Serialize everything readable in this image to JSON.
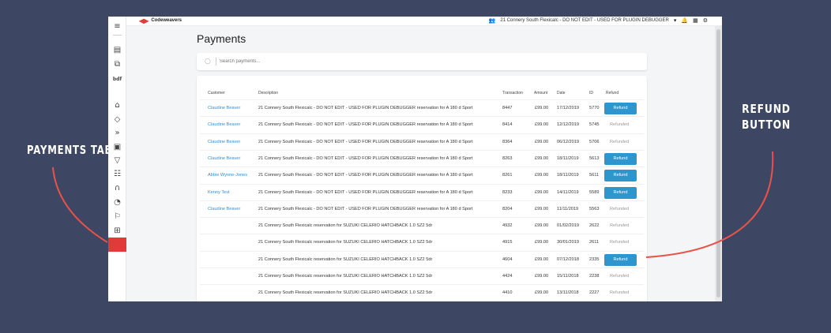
{
  "annotations": {
    "left": "Payments tab",
    "right": "Refund button"
  },
  "topbar": {
    "brand": "Codeweavers",
    "account": "21 Connery South Flexicalc - DO NOT EDIT - USED FOR PLUGIN DEBUGGER",
    "icons": [
      "users-icon",
      "caret-down-icon",
      "bell-icon",
      "grid-icon",
      "cogs-icon"
    ]
  },
  "sidebar": {
    "icons": [
      "menu-icon",
      "document-icon",
      "tag-box-icon",
      "bmf-icon",
      "bank-icon",
      "tag-icon",
      "double-chevron-icon",
      "car-icon",
      "filter-icon",
      "report-icon",
      "routing-icon",
      "tachometer-icon",
      "flag-icon",
      "sitemap-icon",
      "wallet-icon"
    ],
    "active": "wallet-icon"
  },
  "page": {
    "title": "Payments"
  },
  "search": {
    "placeholder": "Search payments..."
  },
  "table": {
    "headers": {
      "customer": "Customer",
      "description": "Description",
      "transaction": "Transaction",
      "amount": "Amount",
      "date": "Date",
      "id": "ID",
      "refund": "Refund"
    },
    "rows": [
      {
        "customer": "Claudine Beaver",
        "description": "21 Connery South Flexicalc - DO NOT EDIT - USED FOR PLUGIN DEBUGGER reservation for A 180 d Sport",
        "transaction": "8447",
        "amount": "£99.00",
        "date": "17/12/2019",
        "id": "5770",
        "refund": "Refund"
      },
      {
        "customer": "Claudine Beaver",
        "description": "21 Connery South Flexicalc - DO NOT EDIT - USED FOR PLUGIN DEBUGGER reservation for A 180 d Sport",
        "transaction": "8414",
        "amount": "£99.00",
        "date": "12/12/2019",
        "id": "5745",
        "refund": "Refunded"
      },
      {
        "customer": "Claudine Beaver",
        "description": "21 Connery South Flexicalc - DO NOT EDIT - USED FOR PLUGIN DEBUGGER reservation for A 180 d Sport",
        "transaction": "8364",
        "amount": "£99.00",
        "date": "06/12/2019",
        "id": "5706",
        "refund": "Refunded"
      },
      {
        "customer": "Claudine Beaver",
        "description": "21 Connery South Flexicalc - DO NOT EDIT - USED FOR PLUGIN DEBUGGER reservation for A 180 d Sport",
        "transaction": "8263",
        "amount": "£99.00",
        "date": "18/11/2019",
        "id": "5613",
        "refund": "Refund"
      },
      {
        "customer": "Abbie Wynne-Jones",
        "description": "21 Connery South Flexicalc - DO NOT EDIT - USED FOR PLUGIN DEBUGGER reservation for A 180 d Sport",
        "transaction": "8261",
        "amount": "£99.00",
        "date": "18/11/2019",
        "id": "5611",
        "refund": "Refund"
      },
      {
        "customer": "Kenny Test",
        "description": "21 Connery South Flexicalc - DO NOT EDIT - USED FOR PLUGIN DEBUGGER reservation for A 180 d Sport",
        "transaction": "8233",
        "amount": "£99.00",
        "date": "14/11/2019",
        "id": "5589",
        "refund": "Refund"
      },
      {
        "customer": "Claudine Beaver",
        "description": "21 Connery South Flexicalc - DO NOT EDIT - USED FOR PLUGIN DEBUGGER reservation for A 180 d Sport",
        "transaction": "8204",
        "amount": "£99.00",
        "date": "11/11/2019",
        "id": "5563",
        "refund": "Refunded"
      },
      {
        "customer": "",
        "description": "21 Connery South Flexicalc reservation for SUZUKI CELERIO HATCHBACK 1.0 SZ2 5dr",
        "transaction": "4932",
        "amount": "£99.00",
        "date": "01/02/2019",
        "id": "2622",
        "refund": "Refunded"
      },
      {
        "customer": "",
        "description": "21 Connery South Flexicalc reservation for SUZUKI CELERIO HATCHBACK 1.0 SZ2 5dr",
        "transaction": "4915",
        "amount": "£99.00",
        "date": "30/01/2019",
        "id": "2611",
        "refund": "Refunded"
      },
      {
        "customer": "",
        "description": "21 Connery South Flexicalc reservation for SUZUKI CELERIO HATCHBACK 1.0 SZ2 5dr",
        "transaction": "4604",
        "amount": "£99.00",
        "date": "07/12/2018",
        "id": "2335",
        "refund": "Refund"
      },
      {
        "customer": "",
        "description": "21 Connery South Flexicalc reservation for SUZUKI CELERIO HATCHBACK 1.0 SZ2 5dr",
        "transaction": "4424",
        "amount": "£99.00",
        "date": "15/11/2018",
        "id": "2238",
        "refund": "Refunded"
      },
      {
        "customer": "",
        "description": "21 Connery South Flexicalc reservation for SUZUKI CELERIO HATCHBACK 1.0 SZ2 5dr",
        "transaction": "4410",
        "amount": "£99.00",
        "date": "13/11/2018",
        "id": "2227",
        "refund": "Refunded"
      }
    ]
  },
  "colors": {
    "background": "#3d4663",
    "accent": "#2d96cf",
    "active_tab": "#e03a3a",
    "annotation_line": "#e8524a",
    "link": "#2f8fd8"
  }
}
